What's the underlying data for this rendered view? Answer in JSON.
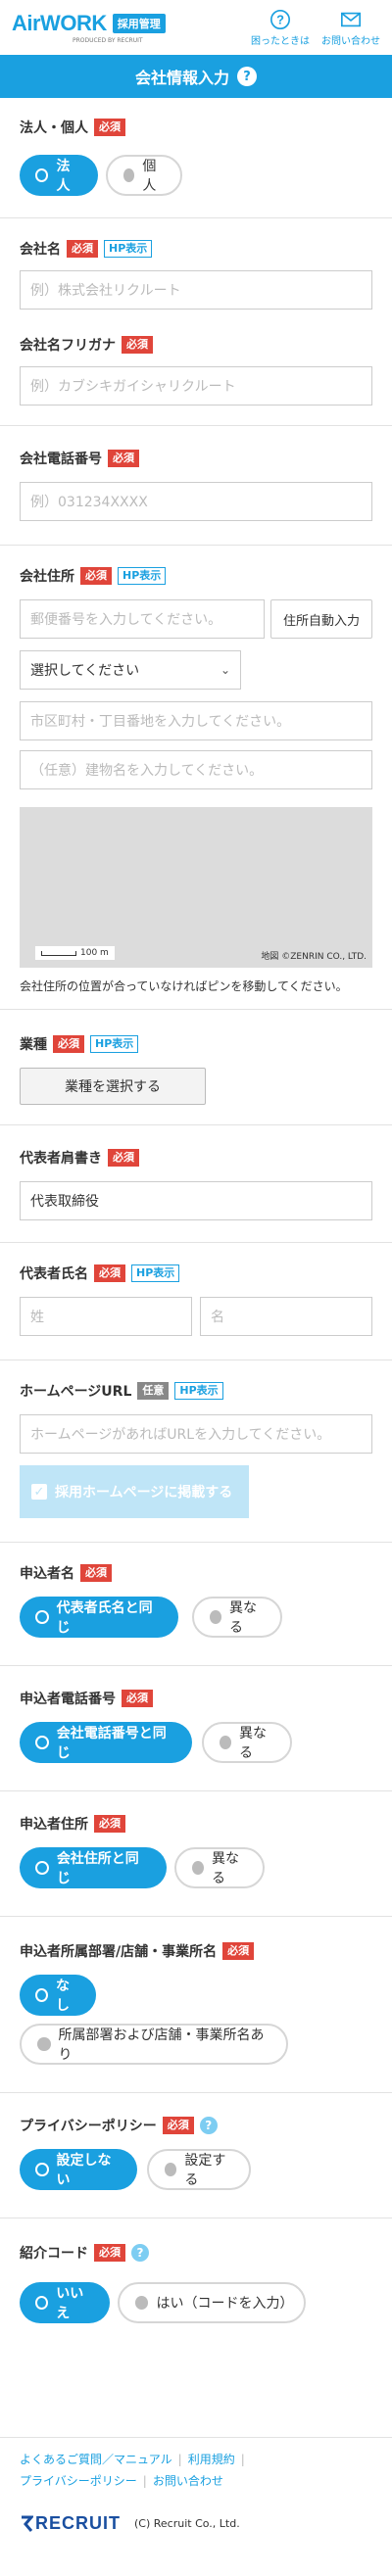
{
  "header": {
    "logo_text": "AirWORK",
    "logo_badge": "採用管理",
    "logo_sub": "PRODUCED BY RECRUIT",
    "help_label": "困ったときは",
    "contact_label": "お問い合わせ"
  },
  "title": {
    "text": "会社情報入力",
    "help": "?"
  },
  "tags": {
    "required": "必須",
    "hp": "HP表示",
    "optional": "任意"
  },
  "corp_type": {
    "label": "法人・個人",
    "options": [
      "法人",
      "個人"
    ],
    "selected": "法人"
  },
  "company_name": {
    "label": "会社名",
    "placeholder": "例）株式会社リクルート"
  },
  "company_kana": {
    "label": "会社名フリガナ",
    "placeholder": "例）カブシキガイシャリクルート"
  },
  "company_phone": {
    "label": "会社電話番号",
    "placeholder": "例）031234XXXX"
  },
  "address": {
    "label": "会社住所",
    "postal_placeholder": "郵便番号を入力してください。",
    "auto_button": "住所自動入力",
    "prefecture_select": "選択してください",
    "city_placeholder": "市区町村・丁目番地を入力してください。",
    "building_placeholder": "（任意）建物名を入力してください。",
    "map_scale": "100 m",
    "map_credit": "地図 ©ZENRIN CO., LTD.",
    "map_note": "会社住所の位置が合っていなければピンを移動してください。"
  },
  "industry": {
    "label": "業種",
    "button": "業種を選択する"
  },
  "rep_title": {
    "label": "代表者肩書き",
    "value": "代表取締役"
  },
  "rep_name": {
    "label": "代表者氏名",
    "last_placeholder": "姓",
    "first_placeholder": "名"
  },
  "homepage": {
    "label": "ホームページURL",
    "placeholder": "ホームページがあればURLを入力してください。",
    "check_label": "採用ホームページに掲載する"
  },
  "applicant": {
    "label": "申込者名",
    "options": [
      "代表者氏名と同じ",
      "異なる"
    ]
  },
  "applicant_phone": {
    "label": "申込者電話番号",
    "options": [
      "会社電話番号と同じ",
      "異なる"
    ]
  },
  "applicant_address": {
    "label": "申込者住所",
    "options": [
      "会社住所と同じ",
      "異なる"
    ]
  },
  "department": {
    "label": "申込者所属部署/店舗・事業所名",
    "options": [
      "なし",
      "所属部署および店舗・事業所名あり"
    ]
  },
  "privacy": {
    "label": "プライバシーポリシー",
    "options": [
      "設定しない",
      "設定する"
    ]
  },
  "referral": {
    "label": "紹介コード",
    "options": [
      "いいえ",
      "はい（コードを入力）"
    ]
  },
  "footer": {
    "links": [
      "よくあるご質問／マニュアル",
      "利用規約",
      "プライバシーポリシー",
      "お問い合わせ"
    ],
    "brand": "RECRUIT",
    "copyright": "(C) Recruit Co., Ltd."
  }
}
